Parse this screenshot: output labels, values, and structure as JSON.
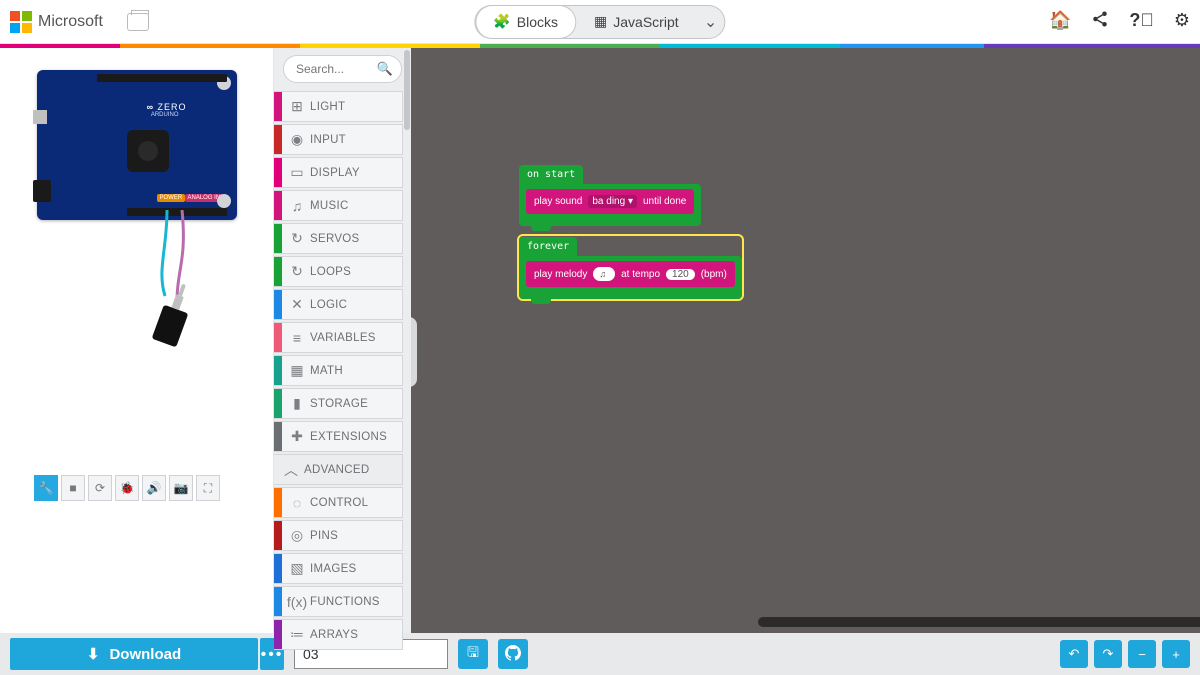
{
  "header": {
    "brand": "Microsoft",
    "tabs": {
      "blocks": "Blocks",
      "javascript": "JavaScript"
    },
    "icons": {
      "home": "⌂",
      "share": "share",
      "help": "❔",
      "settings": "✿"
    }
  },
  "search": {
    "placeholder": "Search..."
  },
  "categories": [
    {
      "label": "LIGHT",
      "color": "#d1157d",
      "icon": "⊞"
    },
    {
      "label": "INPUT",
      "color": "#c92828",
      "icon": "◉"
    },
    {
      "label": "DISPLAY",
      "color": "#e2007a",
      "icon": "▭"
    },
    {
      "label": "MUSIC",
      "color": "#d1157d",
      "icon": "♫"
    },
    {
      "label": "SERVOS",
      "color": "#19a337",
      "icon": "↻"
    },
    {
      "label": "LOOPS",
      "color": "#19a337",
      "icon": "↻"
    },
    {
      "label": "LOGIC",
      "color": "#1e88e5",
      "icon": "✕"
    },
    {
      "label": "VARIABLES",
      "color": "#ef5a78",
      "icon": "≡"
    },
    {
      "label": "MATH",
      "color": "#18a18c",
      "icon": "▦"
    },
    {
      "label": "STORAGE",
      "color": "#1aa36b",
      "icon": "▮"
    },
    {
      "label": "EXTENSIONS",
      "color": "#6b6e73",
      "icon": "✚"
    }
  ],
  "advanced_label": "ADVANCED",
  "advanced": [
    {
      "label": "CONTROL",
      "color": "#ff6f00",
      "icon": "◌"
    },
    {
      "label": "PINS",
      "color": "#b71c1c",
      "icon": "◎"
    },
    {
      "label": "IMAGES",
      "color": "#1e6fd6",
      "icon": "▧"
    },
    {
      "label": "FUNCTIONS",
      "color": "#1e88e5",
      "icon": "f(x)"
    },
    {
      "label": "ARRAYS",
      "color": "#8e24aa",
      "icon": "≔"
    }
  ],
  "sim_toolbar_icons": [
    "🔧",
    "■",
    "⟳",
    "🐞",
    "🔊",
    "📷",
    "⛶"
  ],
  "blocks": {
    "onstart_label": "on start",
    "playsound": {
      "text1": "play sound",
      "sound": "ba ding ▾",
      "text2": "until done"
    },
    "forever_label": "forever",
    "playmelody": {
      "text1": "play melody",
      "tempo_label": "at tempo",
      "tempo": "120",
      "bpm": "(bpm)",
      "notes": [
        "#111",
        "#e03131",
        "#fd7e14",
        "#fab005",
        "#40c057",
        "#15aabf",
        "#228be6",
        "#7950f2"
      ]
    }
  },
  "board": {
    "name": "ZERO",
    "sub": "ARDUINO",
    "lbl1": "POWER",
    "lbl2": "ANALOG IN"
  },
  "footer": {
    "download": "Download",
    "project_name": "03",
    "icons": {
      "save": "🖫",
      "github": "⎋",
      "undo": "↶",
      "redo": "↷",
      "zoom_out": "−",
      "zoom_in": "+"
    }
  }
}
